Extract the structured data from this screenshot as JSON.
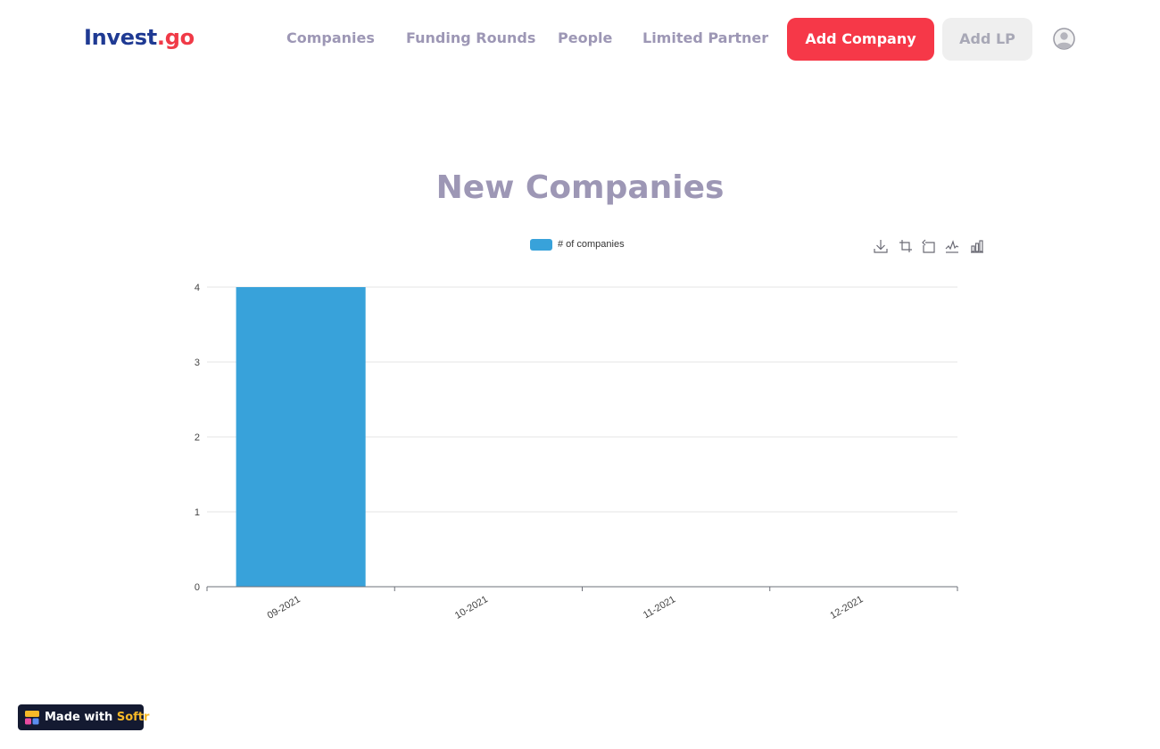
{
  "brand": {
    "name": "Invest",
    "dot": ".",
    "suffix": "go"
  },
  "nav": {
    "links": [
      "Companies",
      "Funding Rounds",
      "People",
      "Limited Partner"
    ],
    "add_company": "Add Company",
    "add_lp": "Add LP"
  },
  "page": {
    "title": "New Companies"
  },
  "colors": {
    "accent": "#f63848",
    "bar": "#38a2da",
    "nav_text": "#9d97b5",
    "brand": "#1f3a93"
  },
  "toolbar": {
    "icons": [
      "download-icon",
      "crop-icon",
      "reset-icon",
      "line-chart-icon",
      "bar-chart-icon"
    ]
  },
  "chart_data": {
    "type": "bar",
    "categories": [
      "09-2021",
      "10-2021",
      "11-2021",
      "12-2021"
    ],
    "series": [
      {
        "name": "# of companies",
        "values": [
          4,
          0,
          0,
          0
        ]
      }
    ],
    "ylim": [
      0,
      4
    ],
    "yticks": [
      0,
      1,
      2,
      3,
      4
    ],
    "grid": true,
    "legend": "top-center"
  },
  "footer": {
    "made_with": "Made with",
    "brand": "Softr"
  }
}
